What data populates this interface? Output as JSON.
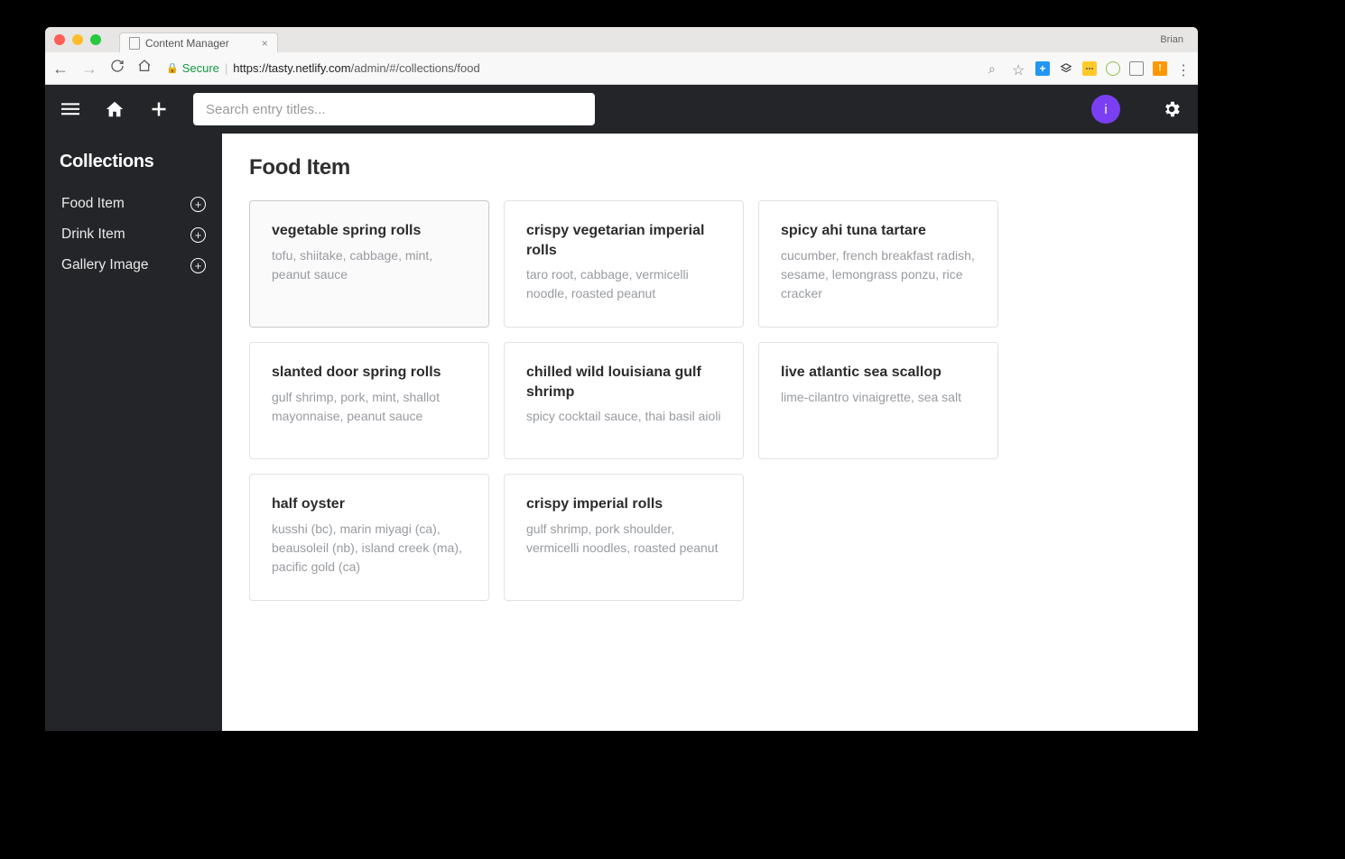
{
  "browser": {
    "tab_title": "Content Manager",
    "profile": "Brian",
    "secure_label": "Secure",
    "url_host": "https://tasty.netlify.com",
    "url_path": "/admin/#/collections/food"
  },
  "header": {
    "search_placeholder": "Search entry titles...",
    "avatar_letter": "i"
  },
  "sidebar": {
    "title": "Collections",
    "items": [
      {
        "label": "Food Item"
      },
      {
        "label": "Drink Item"
      },
      {
        "label": "Gallery Image"
      }
    ]
  },
  "main": {
    "title": "Food Item",
    "cards": [
      {
        "title": "vegetable spring rolls",
        "desc": "tofu, shiitake, cabbage, mint, peanut sauce",
        "selected": true
      },
      {
        "title": "crispy vegetarian imperial rolls",
        "desc": "taro root, cabbage, vermicelli noodle, roasted peanut"
      },
      {
        "title": "spicy ahi tuna tartare",
        "desc": "cucumber, french breakfast radish, sesame, lemongrass ponzu, rice cracker"
      },
      {
        "title": "slanted door spring rolls",
        "desc": "gulf shrimp, pork, mint, shallot mayonnaise, peanut sauce"
      },
      {
        "title": "chilled wild louisiana gulf shrimp",
        "desc": "spicy cocktail sauce, thai basil aioli"
      },
      {
        "title": "live atlantic sea scallop",
        "desc": "lime-cilantro vinaigrette, sea salt"
      },
      {
        "title": "half oyster",
        "desc": "kusshi (bc), marin miyagi (ca), beausoleil (nb), island creek (ma), pacific gold (ca)"
      },
      {
        "title": "crispy imperial rolls",
        "desc": "gulf shrimp, pork shoulder, vermicelli noodles, roasted peanut"
      }
    ]
  }
}
